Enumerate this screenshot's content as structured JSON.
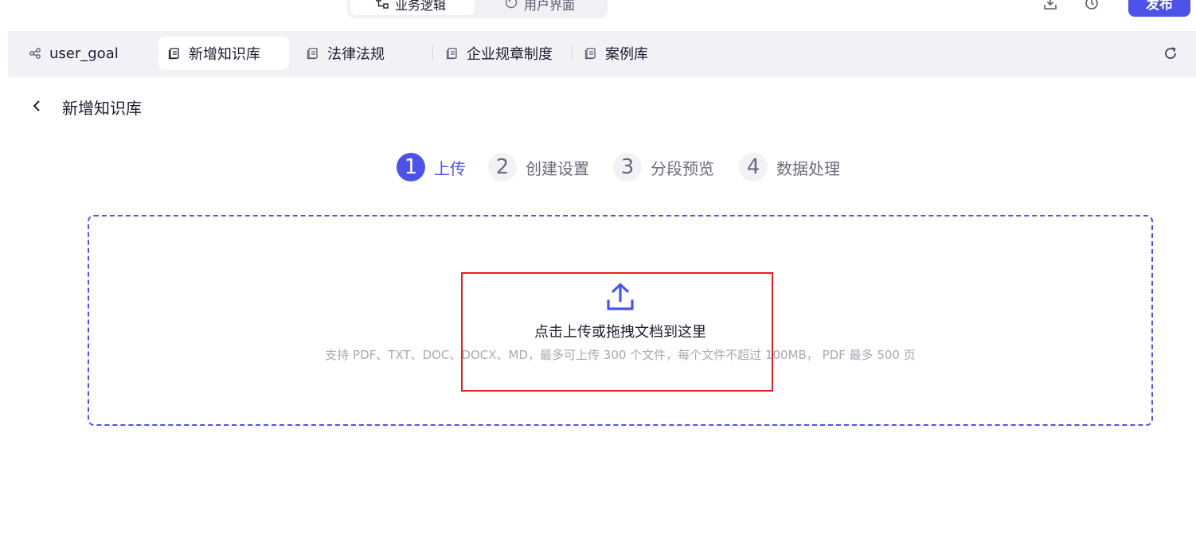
{
  "header": {
    "segments": [
      {
        "label": "业务逻辑",
        "icon": "flow-icon",
        "active": true
      },
      {
        "label": "用户界面",
        "icon": "palette-icon",
        "active": false
      }
    ],
    "publish_label": "发布",
    "icons": [
      "download-icon",
      "history-icon"
    ]
  },
  "tabs": [
    {
      "label": "user_goal",
      "icon": "nodes-icon",
      "active": false
    },
    {
      "label": "新增知识库",
      "icon": "document-icon",
      "active": true
    },
    {
      "label": "法律法规",
      "icon": "document-icon",
      "active": false
    },
    {
      "label": "企业规章制度",
      "icon": "document-icon",
      "active": false
    },
    {
      "label": "案例库",
      "icon": "document-icon",
      "active": false
    }
  ],
  "page": {
    "title": "新增知识库",
    "back_icon": "chevron-left-icon"
  },
  "steps": [
    {
      "num": "1",
      "label": "上传",
      "current": true
    },
    {
      "num": "2",
      "label": "创建设置",
      "current": false
    },
    {
      "num": "3",
      "label": "分段预览",
      "current": false
    },
    {
      "num": "4",
      "label": "数据处理",
      "current": false
    }
  ],
  "upload": {
    "icon": "upload-icon",
    "main_text": "点击上传或拖拽文档到这里",
    "hint_text": "支持 PDF、TXT、DOC、DOCX、MD，最多可上传 300 个文件，每个文件不超过 100MB， PDF 最多 500 页"
  },
  "colors": {
    "accent": "#4d53e8",
    "highlight": "#e02020",
    "tabbar_bg": "#f1f1f6"
  }
}
